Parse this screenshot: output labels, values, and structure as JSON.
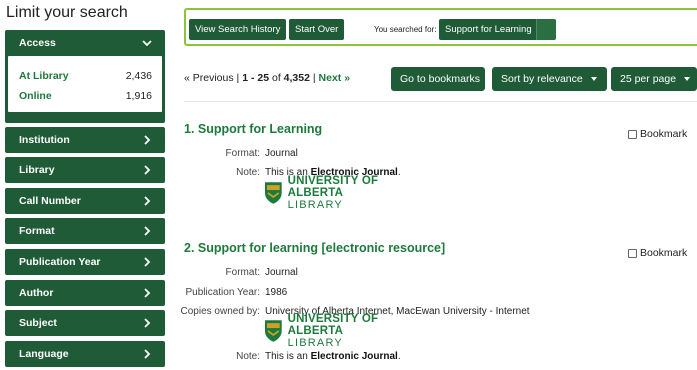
{
  "sidebar": {
    "title": "Limit your search",
    "access": {
      "label": "Access",
      "items": [
        {
          "label": "At Library",
          "count": "2,436"
        },
        {
          "label": "Online",
          "count": "1,916"
        }
      ]
    },
    "facets": [
      "Institution",
      "Library",
      "Call Number",
      "Format",
      "Publication Year",
      "Author",
      "Subject",
      "Language"
    ]
  },
  "searchbar": {
    "view_history": "View Search History",
    "start_over": "Start Over",
    "searched_for": "You searched for:",
    "query": "Support for Learning"
  },
  "toolbar": {
    "previous": "« Previous",
    "sep": "|",
    "range_start": "1",
    "range_dash": "-",
    "range_end": "25",
    "of": "of",
    "total": "4,352",
    "next": "Next »",
    "goto_bookmarks": "Go to bookmarks",
    "sort": "Sort by relevance",
    "per_page": "25 per page"
  },
  "results": [
    {
      "title": "1. Support for Learning",
      "bookmark": "Bookmark",
      "format_label": "Format:",
      "format": "Journal",
      "note_label": "Note:",
      "note_prefix": "This is an",
      "note_bold": "Electronic Journal",
      "note_suffix": "."
    },
    {
      "title": "2. Support for learning [electronic resource]",
      "bookmark": "Bookmark",
      "format_label": "Format:",
      "format": "Journal",
      "pubyear_label": "Publication Year:",
      "pubyear": "1986",
      "copies_label": "Copies owned by:",
      "copies": "University of Alberta Internet, MacEwan University - Internet",
      "note_label": "Note:",
      "note_prefix": "This is an",
      "note_bold": "Electronic Journal",
      "note_suffix": "."
    }
  ],
  "logo": {
    "line1": "UNIVERSITY OF ALBERTA",
    "line2": "LIBRARY"
  },
  "colors": {
    "primary": "#1e5b36",
    "accent": "#8dc33c",
    "link": "#1e7a3c",
    "gold": "#c9a227"
  }
}
